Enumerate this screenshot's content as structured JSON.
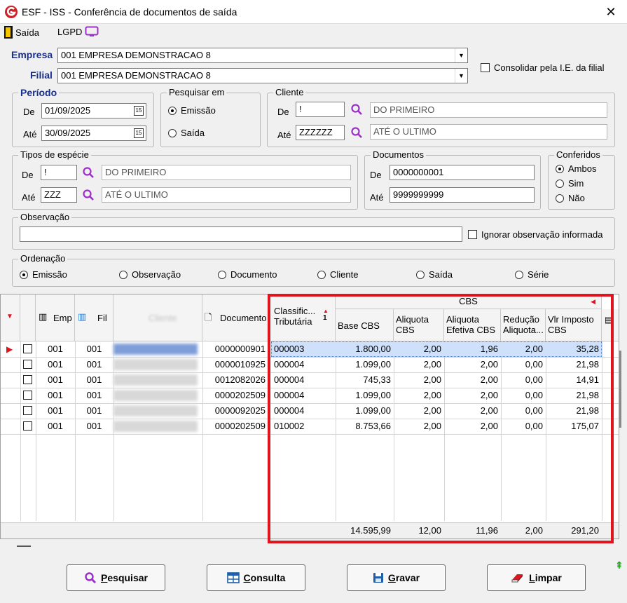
{
  "window": {
    "title": "ESF - ISS - Conferência de documentos de saída",
    "close": "✕"
  },
  "menu": {
    "saida": "Saída",
    "lgpd": "LGPD"
  },
  "empresa": {
    "label": "Empresa",
    "value": "001 EMPRESA DEMONSTRACAO 8"
  },
  "filial": {
    "label": "Filial",
    "value": "001 EMPRESA DEMONSTRACAO 8"
  },
  "consolidar": {
    "label": "Consolidar pela I.E. da filial",
    "checked": false
  },
  "periodo": {
    "title": "Período",
    "de_label": "De",
    "de_value": "01/09/2025",
    "ate_label": "Até",
    "ate_value": "30/09/2025",
    "cal": "15"
  },
  "pesquisar_em": {
    "title": "Pesquisar em",
    "emissao": "Emissão",
    "saida": "Saída"
  },
  "cliente": {
    "title": "Cliente",
    "de_label": "De",
    "de_code": "!",
    "de_name": "DO PRIMEIRO",
    "ate_label": "Até",
    "ate_code": "ZZZZZZ",
    "ate_name": "ATÉ O ULTIMO"
  },
  "tipos_especie": {
    "title": "Tipos de espécie",
    "de_label": "De",
    "de_code": "!",
    "de_name": "DO PRIMEIRO",
    "ate_label": "Até",
    "ate_code": "ZZZ",
    "ate_name": "ATÉ O ULTIMO"
  },
  "documentos": {
    "title": "Documentos",
    "de_label": "De",
    "de_value": "0000000001",
    "ate_label": "Até",
    "ate_value": "9999999999"
  },
  "conferidos": {
    "title": "Conferidos",
    "ambos": "Ambos",
    "sim": "Sim",
    "nao": "Não"
  },
  "observacao": {
    "title": "Observação",
    "value": "",
    "ignorar": "Ignorar observação informada"
  },
  "ordenacao": {
    "title": "Ordenação",
    "options": [
      "Emissão",
      "Observação",
      "Documento",
      "Cliente",
      "Saída",
      "Série"
    ]
  },
  "grid": {
    "headers": {
      "emp": "Emp",
      "fil": "Fil",
      "cliente": "Cliente",
      "documento": "Documento",
      "classif": "Classific... Tributária",
      "sort_index": "1",
      "cbs_group": "CBS",
      "base": "Base CBS",
      "aliquota": "Aliquota CBS",
      "aliquota_efetiva": "Aliquota Efetiva CBS",
      "reducao": "Redução Aliquota...",
      "vlr_imposto": "Vlr Imposto CBS"
    },
    "rows": [
      {
        "emp": "001",
        "fil": "001",
        "cliente": "",
        "documento": "0000000901",
        "classif": "000003",
        "base": "1.800,00",
        "aliquota": "2,00",
        "efetiva": "1,96",
        "reducao": "2,00",
        "vlr": "35,28"
      },
      {
        "emp": "001",
        "fil": "001",
        "cliente": "",
        "documento": "0000010925",
        "classif": "000004",
        "base": "1.099,00",
        "aliquota": "2,00",
        "efetiva": "2,00",
        "reducao": "0,00",
        "vlr": "21,98"
      },
      {
        "emp": "001",
        "fil": "001",
        "cliente": "",
        "documento": "0012082026",
        "classif": "000004",
        "base": "745,33",
        "aliquota": "2,00",
        "efetiva": "2,00",
        "reducao": "0,00",
        "vlr": "14,91"
      },
      {
        "emp": "001",
        "fil": "001",
        "cliente": "",
        "documento": "0000202509",
        "classif": "000004",
        "base": "1.099,00",
        "aliquota": "2,00",
        "efetiva": "2,00",
        "reducao": "0,00",
        "vlr": "21,98"
      },
      {
        "emp": "001",
        "fil": "001",
        "cliente": "",
        "documento": "0000092025",
        "classif": "000004",
        "base": "1.099,00",
        "aliquota": "2,00",
        "efetiva": "2,00",
        "reducao": "0,00",
        "vlr": "21,98"
      },
      {
        "emp": "001",
        "fil": "001",
        "cliente": "",
        "documento": "0000202509",
        "classif": "010002",
        "base": "8.753,66",
        "aliquota": "2,00",
        "efetiva": "2,00",
        "reducao": "0,00",
        "vlr": "175,07"
      }
    ],
    "totals": {
      "base": "14.595,99",
      "aliquota": "12,00",
      "efetiva": "11,96",
      "reducao": "2,00",
      "vlr": "291,20"
    }
  },
  "buttons": {
    "pesquisar_u": "P",
    "pesquisar": "esquisar",
    "consulta_u": "C",
    "consulta": "onsulta",
    "gravar_u": "G",
    "gravar": "ravar",
    "limpar_u": "L",
    "limpar": "impar"
  },
  "colors": {
    "accent": "#1a2f8a",
    "highlight": "#e0141e",
    "selected_row": "#cfe0fa"
  }
}
